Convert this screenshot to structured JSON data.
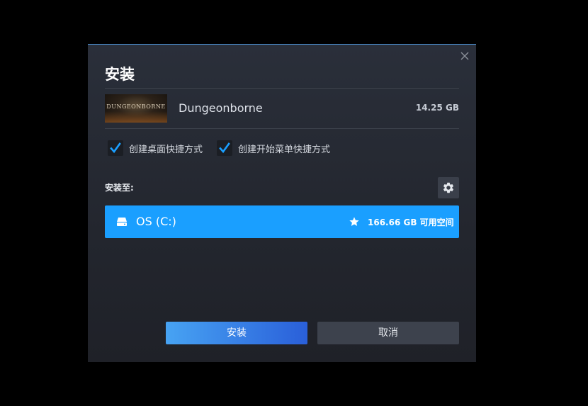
{
  "dialog": {
    "title": "安装",
    "close_icon": "close-icon"
  },
  "game": {
    "name": "Dungeonborne",
    "size": "14.25 GB",
    "thumbnail_logo": "DUNGEONBORNE"
  },
  "options": [
    {
      "label": "创建桌面快捷方式",
      "checked": true
    },
    {
      "label": "创建开始菜单快捷方式",
      "checked": true
    }
  ],
  "install_location": {
    "label": "安装至:",
    "settings_icon": "gear-icon",
    "drive": {
      "name": "OS (C:)",
      "free_space": "166.66 GB 可用空间",
      "icon": "drive-icon",
      "default_icon": "star-icon",
      "selected": true
    }
  },
  "buttons": {
    "install": "安装",
    "cancel": "取消"
  },
  "colors": {
    "accent": "#1a9fff",
    "dialog_bg": "#23262e",
    "border_top": "#4b8fd1",
    "button_secondary": "#3d424d"
  }
}
